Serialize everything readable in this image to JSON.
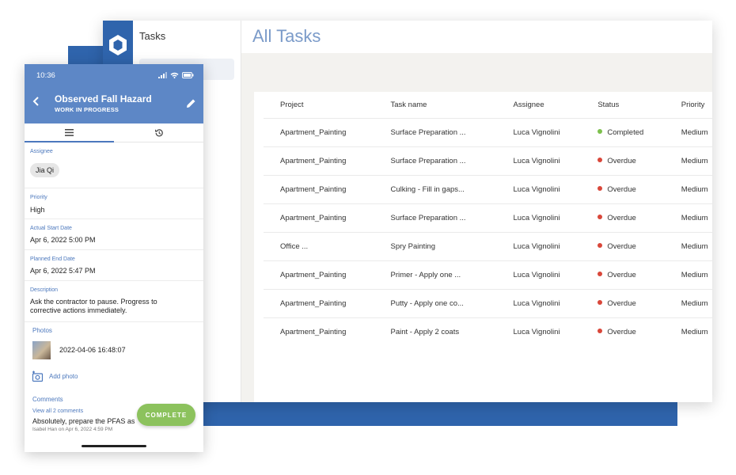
{
  "desktop": {
    "sidebar_title": "Tasks",
    "page_title": "All Tasks",
    "columns": [
      "Project",
      "Task name",
      "Assignee",
      "Status",
      "Priority"
    ],
    "rows": [
      {
        "project": "Apartment_Painting",
        "task": "Surface Preparation ...",
        "assignee": "Luca Vignolini",
        "status": "Completed",
        "status_color": "#7dc04d",
        "priority": "Medium"
      },
      {
        "project": "Apartment_Painting",
        "task": "Surface Preparation ...",
        "assignee": "Luca Vignolini",
        "status": "Overdue",
        "status_color": "#d9473a",
        "priority": "Medium"
      },
      {
        "project": "Apartment_Painting",
        "task": "Culking - Fill in gaps...",
        "assignee": "Luca Vignolini",
        "status": "Overdue",
        "status_color": "#d9473a",
        "priority": "Medium"
      },
      {
        "project": "Apartment_Painting",
        "task": "Surface Preparation ...",
        "assignee": "Luca Vignolini",
        "status": "Overdue",
        "status_color": "#d9473a",
        "priority": "Medium"
      },
      {
        "project": "Office ...",
        "task": "Spry Painting",
        "assignee": "Luca Vignolini",
        "status": "Overdue",
        "status_color": "#d9473a",
        "priority": "Medium"
      },
      {
        "project": "Apartment_Painting",
        "task": "Primer - Apply one ...",
        "assignee": "Luca Vignolini",
        "status": "Overdue",
        "status_color": "#d9473a",
        "priority": "Medium"
      },
      {
        "project": "Apartment_Painting",
        "task": "Putty - Apply one co...",
        "assignee": "Luca Vignolini",
        "status": "Overdue",
        "status_color": "#d9473a",
        "priority": "Medium"
      },
      {
        "project": "Apartment_Painting",
        "task": "Paint - Apply 2 coats",
        "assignee": "Luca Vignolini",
        "status": "Overdue",
        "status_color": "#d9473a",
        "priority": "Medium"
      }
    ]
  },
  "phone": {
    "time": "10:36",
    "title": "Observed Fall Hazard",
    "subtitle": "WORK IN PROGRESS",
    "fields": {
      "assignee_label": "Assignee",
      "assignee_value": "Jia Qi",
      "priority_label": "Priority",
      "priority_value": "High",
      "start_label": "Actual Start Date",
      "start_value": "Apr 6, 2022 5:00 PM",
      "end_label": "Planned End Date",
      "end_value": "Apr 6, 2022 5:47 PM",
      "description_label": "Description",
      "description_line1": "Ask the contractor to pause. Progress to",
      "description_line2": "corrective actions immediately."
    },
    "photos": {
      "title": "Photos",
      "item": "2022-04-06 16:48:07",
      "add_label": "Add photo"
    },
    "comments": {
      "title": "Comments",
      "view_all": "View all 2 comments",
      "text": "Absolutely, prepare the PFAS as",
      "meta": "Isabel Han on Apr 6, 2022 4:59 PM"
    },
    "complete_label": "COMPLETE"
  },
  "colors": {
    "brand_blue": "#2f64ac",
    "phone_header": "#5d87c6",
    "complete_green": "#8cc25d",
    "status_completed": "#7dc04d",
    "status_overdue": "#d9473a"
  }
}
